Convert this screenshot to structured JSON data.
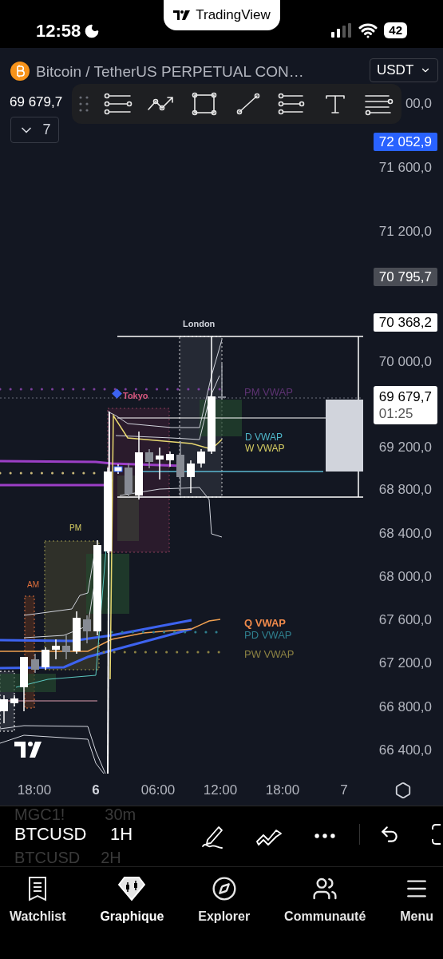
{
  "status_bar": {
    "time": "12:58",
    "battery": "42"
  },
  "app_badge": {
    "name": "TradingView"
  },
  "symbol": {
    "title": "Bitcoin / TetherUS PERPETUAL CON…",
    "price": "69 679,7",
    "currency": "USDT",
    "indicators_count": "7"
  },
  "price_axis": [
    {
      "kind": "tick",
      "label": "00,0"
    },
    {
      "kind": "badge",
      "label": "72 052,9",
      "color": "#2962ff"
    },
    {
      "kind": "tick",
      "label": "71 600,0"
    },
    {
      "kind": "tick",
      "label": "71 200,0"
    },
    {
      "kind": "badge",
      "label": "70 795,7",
      "color": "#4a4d55"
    },
    {
      "kind": "badge",
      "label": "70 368,2",
      "color": "#ffffff"
    },
    {
      "kind": "tick",
      "label": "70 000,0"
    },
    {
      "kind": "last",
      "label": "69 679,7",
      "countdown": "01:25"
    },
    {
      "kind": "tick",
      "label": "69 200,0"
    },
    {
      "kind": "tick",
      "label": "68 800,0"
    },
    {
      "kind": "tick",
      "label": "68 400,0"
    },
    {
      "kind": "tick",
      "label": "68 000,0"
    },
    {
      "kind": "tick",
      "label": "67 600,0"
    },
    {
      "kind": "tick",
      "label": "67 200,0"
    },
    {
      "kind": "tick",
      "label": "66 800,0"
    },
    {
      "kind": "tick",
      "label": "66 400,0"
    }
  ],
  "chart_labels": [
    {
      "text": "London",
      "color": "#d1d4dc"
    },
    {
      "text": "Tokyo",
      "color": "#d9587f"
    },
    {
      "text": "PM VWAP",
      "color": "#5e3373"
    },
    {
      "text": "D VWAP",
      "color": "#4fb6c9"
    },
    {
      "text": "W VWAP",
      "color": "#d8cf63"
    },
    {
      "text": "PM",
      "color": "#d8cf63"
    },
    {
      "text": "AM",
      "color": "#e0703c"
    },
    {
      "text": "Q VWAP",
      "color": "#f08a4b"
    },
    {
      "text": "PD VWAP",
      "color": "#2f7f8e"
    },
    {
      "text": "PW VWAP",
      "color": "#8c8243"
    }
  ],
  "time_axis": [
    {
      "label": "18:00",
      "bold": false
    },
    {
      "label": "6",
      "bold": true
    },
    {
      "label": "06:00",
      "bold": false
    },
    {
      "label": "12:00",
      "bold": false
    },
    {
      "label": "18:00",
      "bold": false
    },
    {
      "label": "7",
      "bold": false
    }
  ],
  "symbol_picker": {
    "above": {
      "symbol": "MGC1!",
      "interval": "30m"
    },
    "current": {
      "symbol": "BTCUSD",
      "interval": "1H"
    },
    "below": {
      "symbol": "BTCUSD",
      "interval": "2H"
    }
  },
  "tab_bar": [
    {
      "label": "Watchlist",
      "selected": false
    },
    {
      "label": "Graphique",
      "selected": true
    },
    {
      "label": "Explorer",
      "selected": false
    },
    {
      "label": "Communauté",
      "selected": false
    },
    {
      "label": "Menu",
      "selected": false
    }
  ]
}
